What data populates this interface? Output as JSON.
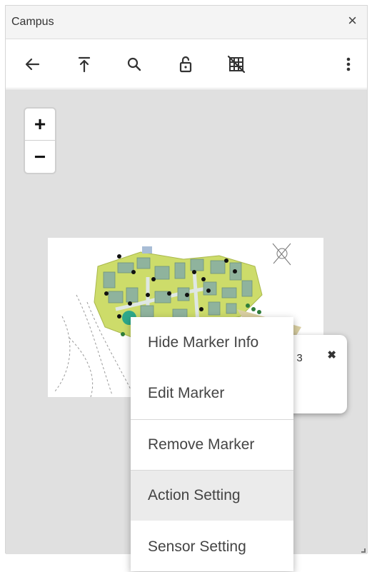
{
  "window": {
    "title": "Campus",
    "close_glyph": "×"
  },
  "toolbar": {
    "buttons": [
      {
        "name": "back",
        "icon": "arrow-left-icon"
      },
      {
        "name": "top",
        "icon": "arrow-to-top-icon"
      },
      {
        "name": "search",
        "icon": "search-icon"
      },
      {
        "name": "lock",
        "icon": "unlocked-padlock-icon"
      },
      {
        "name": "grid",
        "icon": "grid-off-icon"
      },
      {
        "name": "more",
        "icon": "more-vertical-icon"
      }
    ]
  },
  "map": {
    "zoom_in": "+",
    "zoom_out": "−",
    "popup": {
      "text": "rt 3",
      "close_glyph": "✖"
    }
  },
  "context_menu": {
    "items": [
      {
        "label": "Hide Marker Info"
      },
      {
        "label": "Edit Marker"
      },
      {
        "label": "Remove Marker"
      },
      {
        "label": "Action Setting"
      },
      {
        "label": "Sensor Setting"
      }
    ]
  },
  "colors": {
    "map_background": "#e0e0e0",
    "campus_green": "#cddc6a",
    "building": "#8fb39d",
    "highlight": "#ebebeb"
  }
}
